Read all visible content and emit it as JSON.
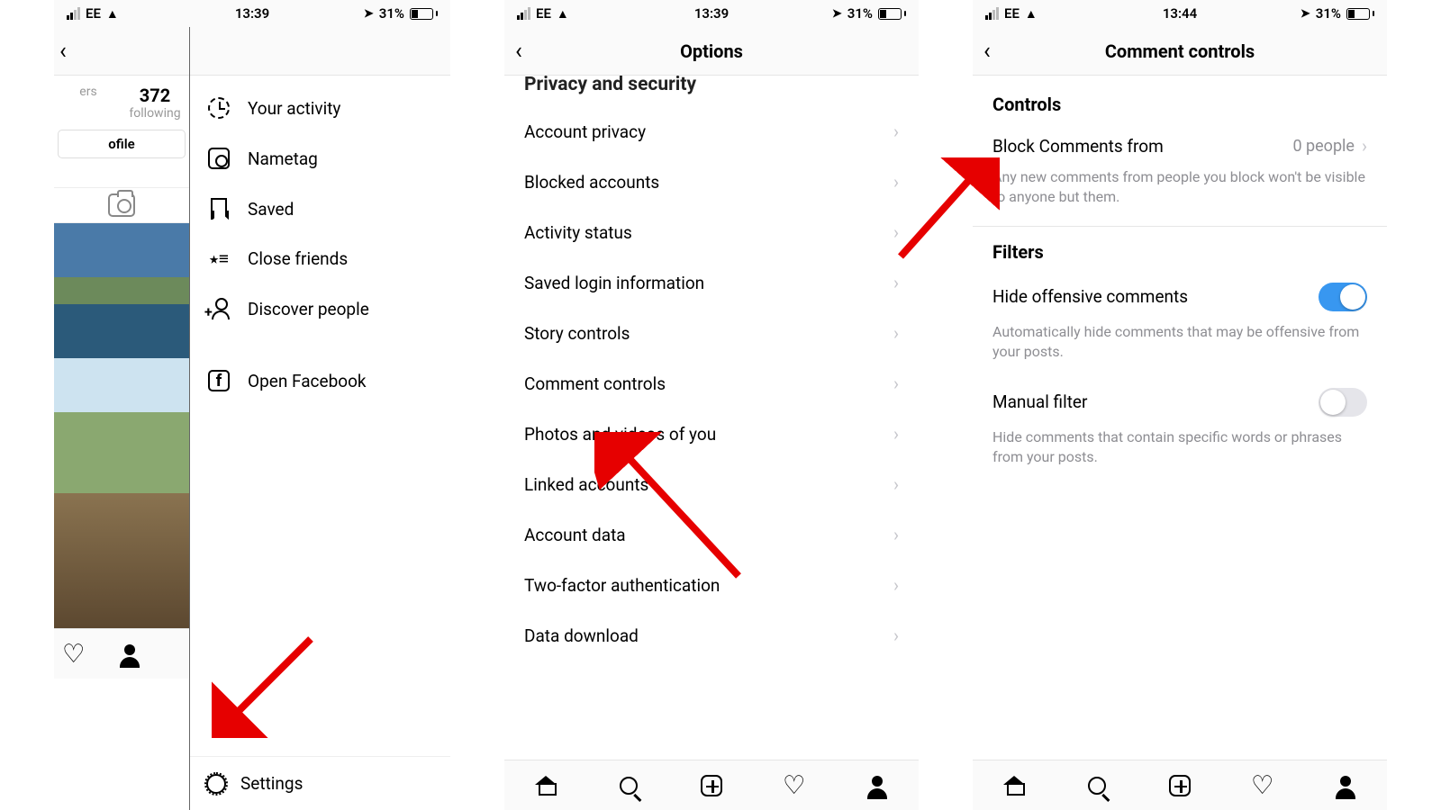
{
  "statusbar": {
    "carrier": "EE",
    "time1": "13:39",
    "time2": "13:39",
    "time3": "13:44",
    "battery_pct": "31%"
  },
  "phone1": {
    "stats": {
      "following_num": "372",
      "following_lab": "following",
      "ers_lab": "ers"
    },
    "edit_profile": "ofile",
    "menu": {
      "activity": "Your activity",
      "nametag": "Nametag",
      "saved": "Saved",
      "close_friends": "Close friends",
      "discover": "Discover people",
      "open_fb": "Open Facebook"
    },
    "settings": "Settings"
  },
  "phone2": {
    "title": "Options",
    "section": "Privacy and security",
    "rows": {
      "account_privacy": "Account privacy",
      "blocked_accounts": "Blocked accounts",
      "activity_status": "Activity status",
      "saved_login": "Saved login information",
      "story_controls": "Story controls",
      "comment_controls": "Comment controls",
      "photos_videos": "Photos and videos of you",
      "linked_accounts": "Linked accounts",
      "account_data": "Account data",
      "two_factor": "Two-factor authentication",
      "data_download": "Data download"
    }
  },
  "phone3": {
    "title": "Comment controls",
    "controls_header": "Controls",
    "block_from_label": "Block Comments from",
    "block_from_value": "0 people",
    "block_from_desc": "Any new comments from people you block won't be visible to anyone but them.",
    "filters_header": "Filters",
    "hide_offensive_label": "Hide offensive comments",
    "hide_offensive_desc": "Automatically hide comments that may be offensive from your posts.",
    "manual_filter_label": "Manual filter",
    "manual_filter_desc": "Hide comments that contain specific words or phrases from your posts."
  }
}
